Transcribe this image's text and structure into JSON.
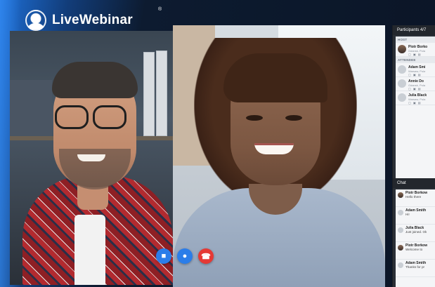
{
  "app": {
    "logo_text": "LiveWebinar",
    "logo_mark": "®"
  },
  "colors": {
    "accent_blue": "#2b7de9",
    "end_call_red": "#e53935",
    "panel_dark": "#2a2f36"
  },
  "controls": [
    {
      "name": "camera-button",
      "icon": "video-camera-icon",
      "glyph": "■"
    },
    {
      "name": "microphone-button",
      "icon": "microphone-icon",
      "glyph": "●"
    },
    {
      "name": "end-call-button",
      "icon": "phone-hangup-icon",
      "glyph": "☎"
    }
  ],
  "participants": {
    "header": "Participants 4/7",
    "host_label": "HOST",
    "attendee_label": "ATTENDEE",
    "host": {
      "name": "Piotr Borko",
      "location": "Gdansk, Pola",
      "icons": "▢ ▣ ▤"
    },
    "attendees": [
      {
        "name": "Adam Smi",
        "location": "Warsaw, Pola",
        "icons": "▢ ▣ ▤"
      },
      {
        "name": "Annie Do",
        "location": "Gdansk, Pola",
        "icons": "▢ ▣ ▤"
      },
      {
        "name": "Julia Black",
        "location": "Warsaw, Pola",
        "icons": "▢ ▣ ▤"
      }
    ]
  },
  "chat": {
    "header": "Chat",
    "messages": [
      {
        "name": "Piotr Borkow",
        "text": "Hello there",
        "photo": true
      },
      {
        "name": "Adam Smith",
        "text": "Hi!",
        "photo": false
      },
      {
        "name": "Julia Black",
        "text": "Just joined. Ok",
        "photo": false
      },
      {
        "name": "Piotr Borkow",
        "text": "Welcome to",
        "photo": true
      },
      {
        "name": "Adam Smith",
        "text": "Thanks for pr",
        "photo": false
      }
    ]
  }
}
